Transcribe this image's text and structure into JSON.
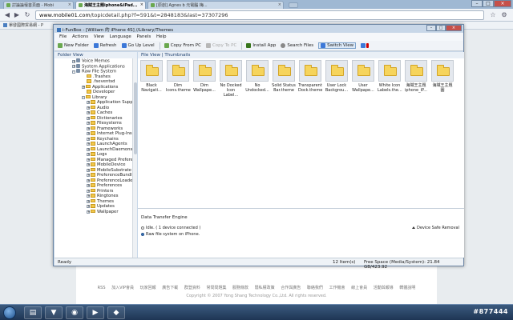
{
  "browser": {
    "tabs": [
      {
        "label": "討論論壇首頁面 - Mobi"
      },
      {
        "label": "海賊王主題iphone&iPad..."
      },
      {
        "label": "[原創] Agnes b 元電腦 梅..."
      }
    ],
    "url_prefix": "www.mobile01.com",
    "url_rest": "/topicdetail.php?f=591&t=2848183&last=37307296",
    "bookmark": "單發國際貿易網 - P"
  },
  "app": {
    "title": "i-FunBox - [William 的 iPhone 4S] //Library/Themes",
    "menu": [
      "File",
      "Actions",
      "View",
      "Language",
      "Panels",
      "Help"
    ],
    "toolbar": [
      {
        "label": "New Folder",
        "icon": "new-folder-icon",
        "color": "#6aa84f"
      },
      {
        "label": "Refresh",
        "icon": "refresh-icon",
        "color": "#3c78d8"
      },
      {
        "label": "Go Up Level",
        "icon": "go-up-icon",
        "color": "#3c78d8"
      },
      {
        "label": "Copy From PC",
        "icon": "copy-from-pc-icon",
        "color": "#6aa84f"
      },
      {
        "label": "Copy To PC",
        "icon": "copy-to-pc-icon",
        "color": "#b7b7b7"
      },
      {
        "label": "Install App",
        "icon": "install-app-icon",
        "color": "#38761d"
      },
      {
        "label": "Search Files",
        "icon": "search-icon",
        "color": "#888888"
      },
      {
        "label": "Switch View",
        "icon": "switch-view-icon",
        "color": "#3c78d8"
      }
    ],
    "folder_view_label": "Folder View",
    "file_view_label": "File View | Thumbnails",
    "tree": [
      {
        "label": "Voice Memos",
        "depth": 1,
        "expander": "+"
      },
      {
        "label": "System Applications",
        "depth": 1,
        "expander": "+"
      },
      {
        "label": "Raw File System",
        "depth": 1,
        "expander": "-"
      },
      {
        "label": ".Trashes",
        "depth": 2,
        "expander": ""
      },
      {
        "label": ".fseventsd",
        "depth": 2,
        "expander": ""
      },
      {
        "label": "Applications",
        "depth": 2,
        "expander": "+"
      },
      {
        "label": "Developer",
        "depth": 2,
        "expander": ""
      },
      {
        "label": "Library",
        "depth": 2,
        "expander": "-"
      },
      {
        "label": "Application Supp",
        "depth": 3,
        "expander": "+"
      },
      {
        "label": "Audio",
        "depth": 3,
        "expander": "+"
      },
      {
        "label": "Caches",
        "depth": 3,
        "expander": "+"
      },
      {
        "label": "Dictionaries",
        "depth": 3,
        "expander": "+"
      },
      {
        "label": "Filesystems",
        "depth": 3,
        "expander": "+"
      },
      {
        "label": "Frameworks",
        "depth": 3,
        "expander": "+"
      },
      {
        "label": "Internet Plug-Ins",
        "depth": 3,
        "expander": "+"
      },
      {
        "label": "Keychains",
        "depth": 3,
        "expander": "+"
      },
      {
        "label": "LaunchAgents",
        "depth": 3,
        "expander": "+"
      },
      {
        "label": "LaunchDaemons",
        "depth": 3,
        "expander": "+"
      },
      {
        "label": "Logs",
        "depth": 3,
        "expander": "+"
      },
      {
        "label": "Managed Prefere",
        "depth": 3,
        "expander": "+"
      },
      {
        "label": "MobileDevice",
        "depth": 3,
        "expander": "+"
      },
      {
        "label": "MobileSubstrate",
        "depth": 3,
        "expander": "+"
      },
      {
        "label": "PreferenceBundle",
        "depth": 3,
        "expander": "+"
      },
      {
        "label": "PreferenceLoade",
        "depth": 3,
        "expander": "+"
      },
      {
        "label": "Preferences",
        "depth": 3,
        "expander": "+"
      },
      {
        "label": "Printers",
        "depth": 3,
        "expander": "+"
      },
      {
        "label": "Ringtones",
        "depth": 3,
        "expander": "+"
      },
      {
        "label": "Themes",
        "depth": 3,
        "expander": "+"
      },
      {
        "label": "Updates",
        "depth": 3,
        "expander": "+"
      },
      {
        "label": "Wallpaper",
        "depth": 3,
        "expander": "+"
      }
    ],
    "files": [
      {
        "line1": "Black",
        "line2": "Navigati..."
      },
      {
        "line1": "Dim",
        "line2": "Icons.theme"
      },
      {
        "line1": "Dim",
        "line2": "Wallpape..."
      },
      {
        "line1": "No Docked",
        "line2": "Icon Label..."
      },
      {
        "line1": "No",
        "line2": "Undocked..."
      },
      {
        "line1": "Solid Status",
        "line2": "Bar.theme"
      },
      {
        "line1": "Transparent",
        "line2": "Dock.theme"
      },
      {
        "line1": "User Lock",
        "line2": "Backgrou..."
      },
      {
        "line1": "User",
        "line2": "Wallpape..."
      },
      {
        "line1": "White Icon",
        "line2": "Labels.the..."
      },
      {
        "line1": "海賊王主題",
        "line2": "iphone_iP..."
      },
      {
        "line1": "海賊王主題",
        "line2": "圖"
      }
    ],
    "transfer": {
      "title": "Data Transfer Engine",
      "idle": "Idle. ( 1 device connected )",
      "raw": "Raw file system on iPhone.",
      "safe_remove": "Device Safe Removal"
    },
    "status": {
      "ready": "Ready",
      "count": "12 Item(s)",
      "space": "Free Space (Media/System): 21.84 GB/423.92"
    }
  },
  "page": {
    "footer_links": [
      "RSS",
      "加入VIP會員",
      "玩家回報",
      "廣告下載",
      "群登資料",
      "常問問題集",
      "服務條款",
      "隱私權政策",
      "合作與廣告",
      "聯絡我們",
      "工作機會",
      "線上會員",
      "活動與報導",
      "轉體說明"
    ],
    "copyright": "Copyright © 2007 Yong Shang Technology Co.,Ltd. All rights reserved."
  },
  "taskbar": {
    "watermark": "#877444"
  }
}
